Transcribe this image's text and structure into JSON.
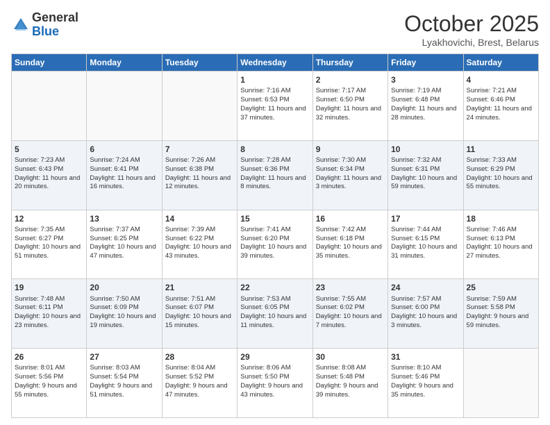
{
  "header": {
    "logo_general": "General",
    "logo_blue": "Blue",
    "month": "October 2025",
    "location": "Lyakhovichi, Brest, Belarus"
  },
  "days_of_week": [
    "Sunday",
    "Monday",
    "Tuesday",
    "Wednesday",
    "Thursday",
    "Friday",
    "Saturday"
  ],
  "weeks": [
    [
      {
        "day": "",
        "info": ""
      },
      {
        "day": "",
        "info": ""
      },
      {
        "day": "",
        "info": ""
      },
      {
        "day": "1",
        "info": "Sunrise: 7:16 AM\nSunset: 6:53 PM\nDaylight: 11 hours and 37 minutes."
      },
      {
        "day": "2",
        "info": "Sunrise: 7:17 AM\nSunset: 6:50 PM\nDaylight: 11 hours and 32 minutes."
      },
      {
        "day": "3",
        "info": "Sunrise: 7:19 AM\nSunset: 6:48 PM\nDaylight: 11 hours and 28 minutes."
      },
      {
        "day": "4",
        "info": "Sunrise: 7:21 AM\nSunset: 6:46 PM\nDaylight: 11 hours and 24 minutes."
      }
    ],
    [
      {
        "day": "5",
        "info": "Sunrise: 7:23 AM\nSunset: 6:43 PM\nDaylight: 11 hours and 20 minutes."
      },
      {
        "day": "6",
        "info": "Sunrise: 7:24 AM\nSunset: 6:41 PM\nDaylight: 11 hours and 16 minutes."
      },
      {
        "day": "7",
        "info": "Sunrise: 7:26 AM\nSunset: 6:38 PM\nDaylight: 11 hours and 12 minutes."
      },
      {
        "day": "8",
        "info": "Sunrise: 7:28 AM\nSunset: 6:36 PM\nDaylight: 11 hours and 8 minutes."
      },
      {
        "day": "9",
        "info": "Sunrise: 7:30 AM\nSunset: 6:34 PM\nDaylight: 11 hours and 3 minutes."
      },
      {
        "day": "10",
        "info": "Sunrise: 7:32 AM\nSunset: 6:31 PM\nDaylight: 10 hours and 59 minutes."
      },
      {
        "day": "11",
        "info": "Sunrise: 7:33 AM\nSunset: 6:29 PM\nDaylight: 10 hours and 55 minutes."
      }
    ],
    [
      {
        "day": "12",
        "info": "Sunrise: 7:35 AM\nSunset: 6:27 PM\nDaylight: 10 hours and 51 minutes."
      },
      {
        "day": "13",
        "info": "Sunrise: 7:37 AM\nSunset: 6:25 PM\nDaylight: 10 hours and 47 minutes."
      },
      {
        "day": "14",
        "info": "Sunrise: 7:39 AM\nSunset: 6:22 PM\nDaylight: 10 hours and 43 minutes."
      },
      {
        "day": "15",
        "info": "Sunrise: 7:41 AM\nSunset: 6:20 PM\nDaylight: 10 hours and 39 minutes."
      },
      {
        "day": "16",
        "info": "Sunrise: 7:42 AM\nSunset: 6:18 PM\nDaylight: 10 hours and 35 minutes."
      },
      {
        "day": "17",
        "info": "Sunrise: 7:44 AM\nSunset: 6:15 PM\nDaylight: 10 hours and 31 minutes."
      },
      {
        "day": "18",
        "info": "Sunrise: 7:46 AM\nSunset: 6:13 PM\nDaylight: 10 hours and 27 minutes."
      }
    ],
    [
      {
        "day": "19",
        "info": "Sunrise: 7:48 AM\nSunset: 6:11 PM\nDaylight: 10 hours and 23 minutes."
      },
      {
        "day": "20",
        "info": "Sunrise: 7:50 AM\nSunset: 6:09 PM\nDaylight: 10 hours and 19 minutes."
      },
      {
        "day": "21",
        "info": "Sunrise: 7:51 AM\nSunset: 6:07 PM\nDaylight: 10 hours and 15 minutes."
      },
      {
        "day": "22",
        "info": "Sunrise: 7:53 AM\nSunset: 6:05 PM\nDaylight: 10 hours and 11 minutes."
      },
      {
        "day": "23",
        "info": "Sunrise: 7:55 AM\nSunset: 6:02 PM\nDaylight: 10 hours and 7 minutes."
      },
      {
        "day": "24",
        "info": "Sunrise: 7:57 AM\nSunset: 6:00 PM\nDaylight: 10 hours and 3 minutes."
      },
      {
        "day": "25",
        "info": "Sunrise: 7:59 AM\nSunset: 5:58 PM\nDaylight: 9 hours and 59 minutes."
      }
    ],
    [
      {
        "day": "26",
        "info": "Sunrise: 8:01 AM\nSunset: 5:56 PM\nDaylight: 9 hours and 55 minutes."
      },
      {
        "day": "27",
        "info": "Sunrise: 8:03 AM\nSunset: 5:54 PM\nDaylight: 9 hours and 51 minutes."
      },
      {
        "day": "28",
        "info": "Sunrise: 8:04 AM\nSunset: 5:52 PM\nDaylight: 9 hours and 47 minutes."
      },
      {
        "day": "29",
        "info": "Sunrise: 8:06 AM\nSunset: 5:50 PM\nDaylight: 9 hours and 43 minutes."
      },
      {
        "day": "30",
        "info": "Sunrise: 8:08 AM\nSunset: 5:48 PM\nDaylight: 9 hours and 39 minutes."
      },
      {
        "day": "31",
        "info": "Sunrise: 8:10 AM\nSunset: 5:46 PM\nDaylight: 9 hours and 35 minutes."
      },
      {
        "day": "",
        "info": ""
      }
    ]
  ]
}
